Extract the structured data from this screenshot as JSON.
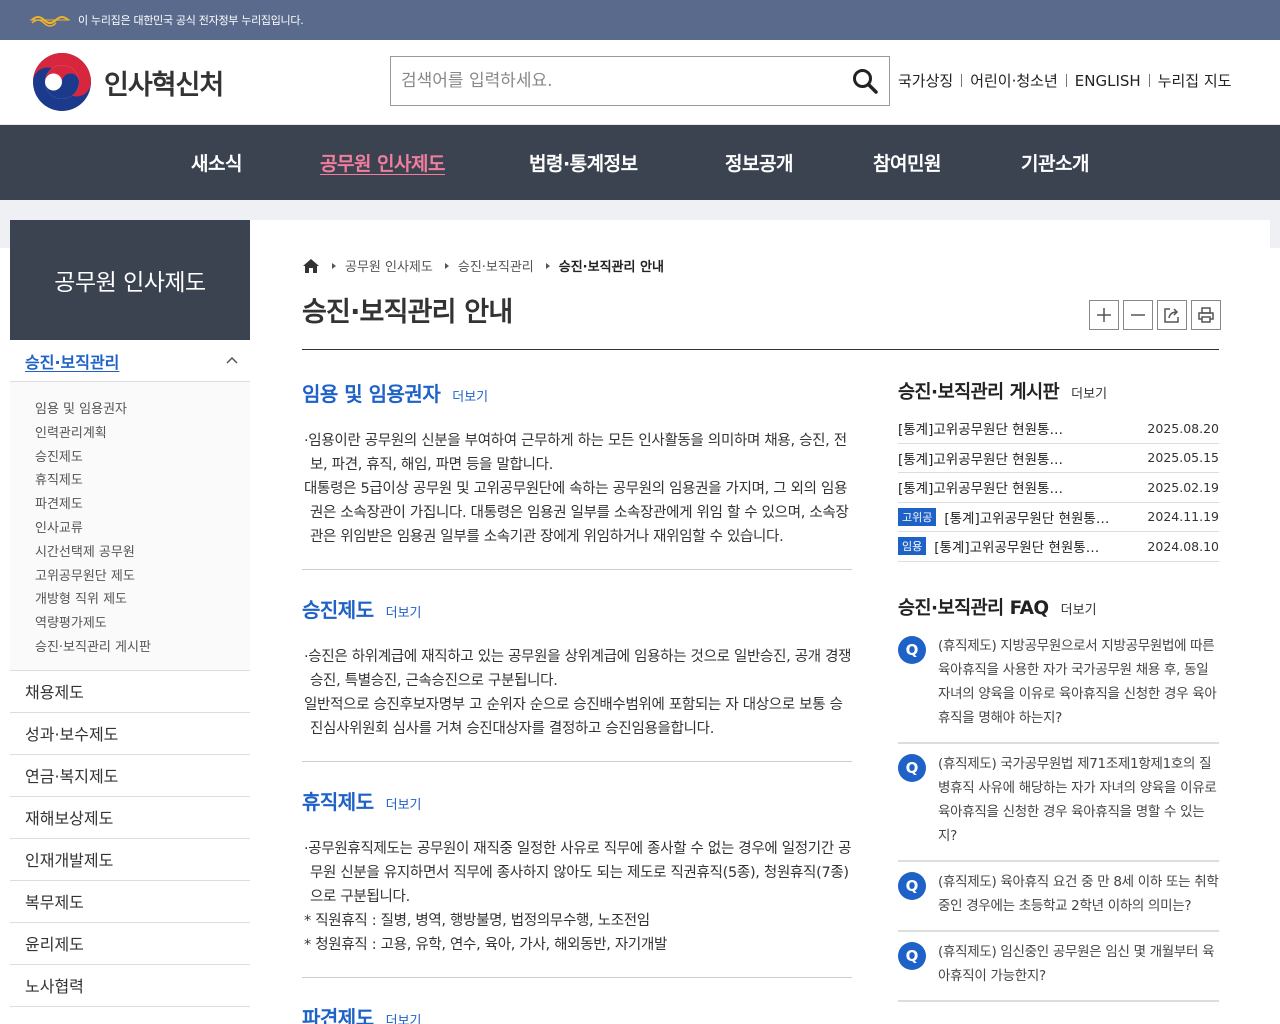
{
  "gov_banner": {
    "text": "이 누리집은 대한민국 공식 전자정부 누리집입니다."
  },
  "header": {
    "org_name": "인사혁신처",
    "search_placeholder": "검색어를 입력하세요.",
    "util_links": [
      "국가상징",
      "어린이·청소년",
      "ENGLISH",
      "누리집 지도"
    ]
  },
  "gnb": {
    "items": [
      "새소식",
      "공무원 인사제도",
      "법령·통계정보",
      "정보공개",
      "참여민원",
      "기관소개"
    ],
    "active": "공무원 인사제도"
  },
  "sidebar": {
    "title": "공무원 인사제도",
    "current": "승진·보직관리",
    "sub_items": [
      "임용 및 임용권자",
      "인력관리계획",
      "승진제도",
      "휴직제도",
      "파견제도",
      "인사교류",
      "시간선택제 공무원",
      "고위공무원단 제도",
      "개방형 직위 제도",
      "역량평가제도",
      "승진·보직관리 게시판"
    ],
    "items": [
      "채용제도",
      "성과·보수제도",
      "연금·복지제도",
      "재해보상제도",
      "인재개발제도",
      "복무제도",
      "윤리제도",
      "노사협력"
    ]
  },
  "breadcrumb": [
    "공무원 인사제도",
    "승진·보직관리",
    "승진·보직관리 안내"
  ],
  "page_title": "승진·보직관리 안내",
  "sections": [
    {
      "title": "임용 및 임용권자",
      "more": "더보기",
      "paragraphs": [
        "·임용이란 공무원의 신분을 부여하여 근무하게 하는 모든 인사활동을 의미하며 채용, 승진, 전보, 파견, 휴직, 해임, 파면 등을 말합니다.",
        "대통령은 5급이상 공무원 및 고위공무원단에 속하는 공무원의 임용권을 가지며, 그 외의 임용권은 소속장관이 가집니다. 대통령은 임용권 일부를 소속장관에게 위임 할 수 있으며, 소속장관은 위임받은 임용권 일부를 소속기관 장에게 위임하거나 재위임할 수 있습니다."
      ]
    },
    {
      "title": "승진제도",
      "more": "더보기",
      "paragraphs": [
        "·승진은 하위계급에 재직하고 있는 공무원을 상위계급에 임용하는 것으로 일반승진, 공개 경쟁승진, 특별승진, 근속승진으로 구분됩니다.",
        "일반적으로 승진후보자명부 고 순위자 순으로 승진배수범위에 포함되는 자 대상으로 보통 승진심사위원회 심사를 거쳐 승진대상자를 결정하고 승진임용을합니다."
      ]
    },
    {
      "title": "휴직제도",
      "more": "더보기",
      "paragraphs": [
        "·공무원휴직제도는 공무원이 재직중 일정한 사유로 직무에 종사할 수 없는 경우에 일정기간 공무원 신분을 유지하면서 직무에 종사하지 않아도 되는 제도로 직권휴직(5종), 청원휴직(7종)으로 구분됩니다.",
        "* 직원휴직 : 질병, 병역, 행방불명, 법정의무수행, 노조전임",
        "* 청원휴직 : 고용, 유학, 연수, 육아, 가사, 해외동반, 자기개발"
      ]
    },
    {
      "title": "파견제도",
      "more": "더보기",
      "paragraphs": []
    }
  ],
  "board": {
    "title": "승진·보직관리 게시판",
    "more": "더보기",
    "rows": [
      {
        "tag": "",
        "title": "[통계]고위공무원단 현원통…",
        "date": "2025.08.20"
      },
      {
        "tag": "",
        "title": "[통계]고위공무원단 현원통…",
        "date": "2025.05.15"
      },
      {
        "tag": "",
        "title": "[통계]고위공무원단 현원통…",
        "date": "2025.02.19"
      },
      {
        "tag": "고위공",
        "title": "[통계]고위공무원단 현원통…",
        "date": "2024.11.19"
      },
      {
        "tag": "임용",
        "title": "[통계]고위공무원단 현원통…",
        "date": "2024.08.10"
      }
    ]
  },
  "faq": {
    "title": "승진·보직관리 FAQ",
    "more": "더보기",
    "badge": "Q",
    "items": [
      "(휴직제도) 지방공무원으로서 지방공무원법에 따른 육아휴직을 사용한 자가 국가공무원 채용 후, 동일 자녀의 양육을 이유로 육아휴직을 신청한 경우 육아휴직을 명해야 하는지?",
      "(휴직제도) 국가공무원법 제71조제1항제1호의 질병휴직 사유에 해당하는 자가 자녀의 양육을 이유로 육아휴직을 신청한 경우 육아휴직을 명할 수 있는지?",
      "(휴직제도) 육아휴직 요건 중 만 8세 이하 또는 취학중인 경우에는 초등학교 2학년 이하의 의미는?",
      "(휴직제도) 임신중인 공무원은 임신 몇 개월부터 육아휴직이 가능한지?"
    ]
  },
  "colors": {
    "accent": "#1e61c7",
    "gnb_bg": "#3b4350",
    "gnb_active": "#f27e9f",
    "banner_bg": "#5a6a8c"
  },
  "icons": [
    "gov-symbol-icon",
    "search-icon",
    "home-icon",
    "zoom-in-icon",
    "zoom-out-icon",
    "share-icon",
    "print-icon",
    "chevron-up-icon"
  ]
}
